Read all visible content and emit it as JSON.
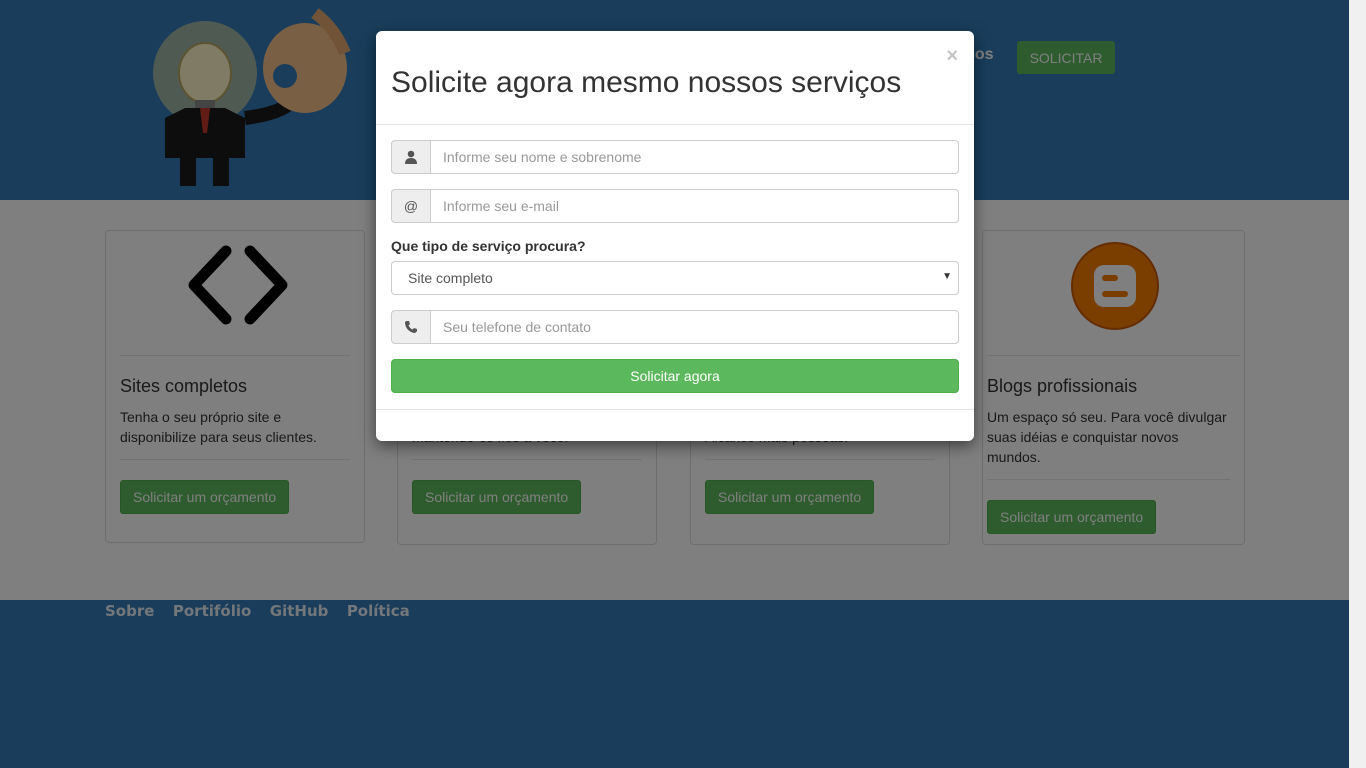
{
  "header": {
    "nav_partial": "ços",
    "solicitar_label": "SOLICITAR"
  },
  "cards": [
    {
      "title": "Sites completos",
      "text": "Tenha o seu próprio site e disponibilize para seus clientes.",
      "button": "Solicitar um orçamento",
      "icon": "code-brackets-icon"
    },
    {
      "title": "",
      "text": "mantendo-os fiés a você.",
      "button": "Solicitar um orçamento",
      "icon": ""
    },
    {
      "title": "",
      "text": "Alcance mais pessoas.",
      "button": "Solicitar um orçamento",
      "icon": ""
    },
    {
      "title": "Blogs profissionais",
      "text": "Um espaço só seu. Para você divulgar suas idéias e conquistar novos mundos.",
      "button": "Solicitar um orçamento",
      "icon": "blogger-icon"
    }
  ],
  "footer": {
    "links": [
      "Sobre",
      "Portifólio",
      "GitHub",
      "Política"
    ]
  },
  "modal": {
    "title": "Solicite agora mesmo nossos serviços",
    "close": "×",
    "name_placeholder": "Informe seu nome e sobrenome",
    "email_addon": "@",
    "email_placeholder": "Informe seu e-mail",
    "service_label": "Que tipo de serviço procura?",
    "service_selected": "Site completo",
    "phone_placeholder": "Seu telefone de contato",
    "submit_label": "Solicitar agora"
  },
  "colors": {
    "primary": "#337ab7",
    "success": "#5cb85c",
    "blogger": "#f57d00"
  }
}
